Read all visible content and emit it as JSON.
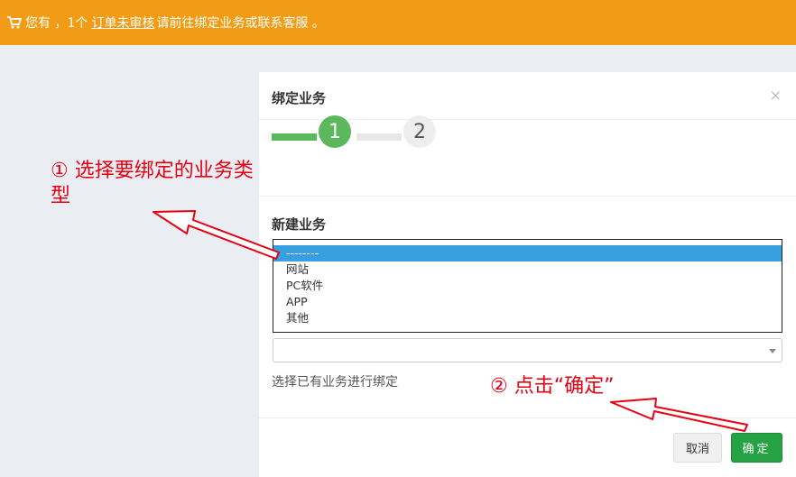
{
  "notice": {
    "text_prefix": "您有 ，1个",
    "link_text": "订单未审核",
    "text_suffix": "请前往绑定业务或联系客服 。"
  },
  "modal": {
    "title": "绑定业务",
    "close": "×",
    "steps": [
      "1",
      "2"
    ],
    "current_step": 1,
    "section_title": "新建业务",
    "listbox_options": [
      "--------",
      "网站",
      "PC软件",
      "APP",
      "其他"
    ],
    "selected_option": "--------",
    "combo_value": "",
    "help_text": "选择已有业务进行绑定",
    "cancel_label": "取消",
    "confirm_label": "确定"
  },
  "annotations": {
    "a1": "① 选择要绑定的业务类型",
    "a2": "② 点击“确定”",
    "color": "#e60012"
  },
  "colors": {
    "notice_bg": "#f29b14",
    "step_active": "#5cb85c",
    "selected_bg": "#39a0df",
    "confirm_bg": "#25a243"
  }
}
